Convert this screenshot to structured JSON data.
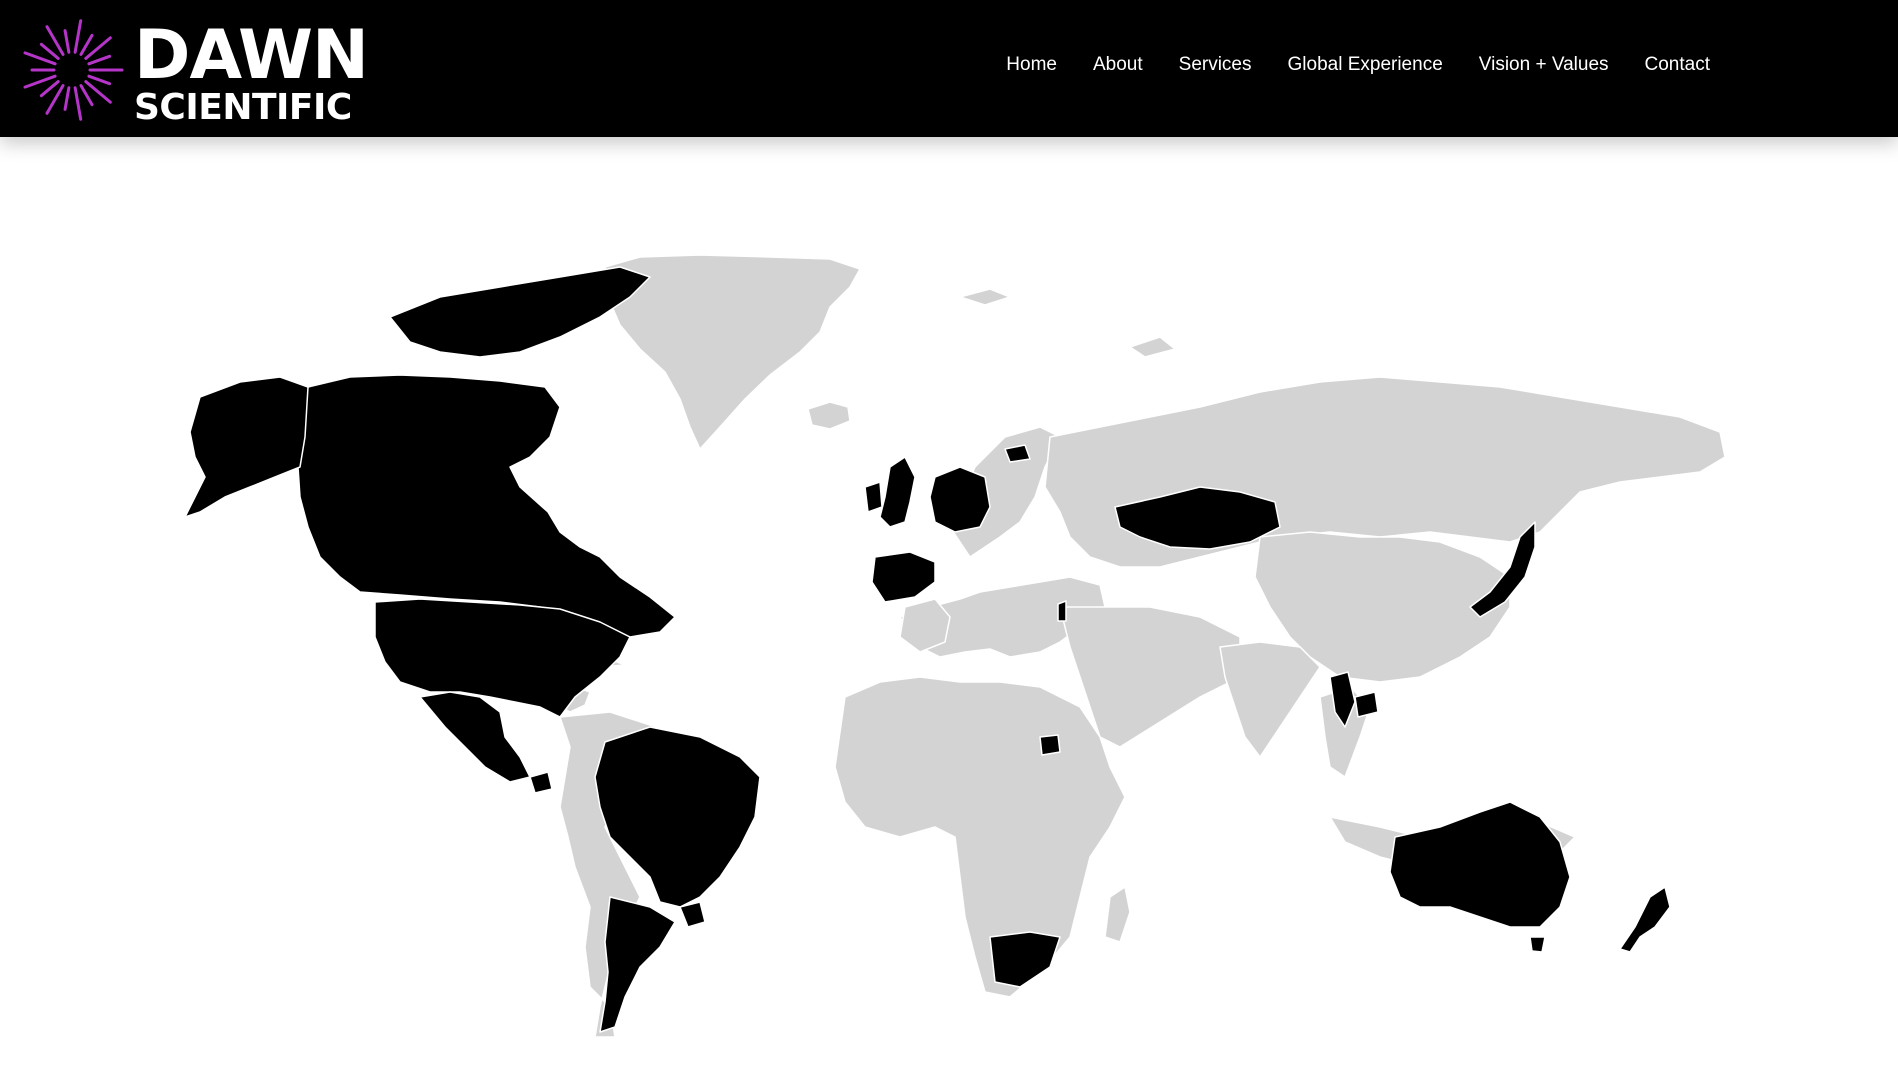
{
  "brand": {
    "line1": "DAWN",
    "line2": "SCIENTIFIC",
    "icon": "sunburst-logo-icon",
    "accent_color": "#b535c8"
  },
  "nav": {
    "items": [
      {
        "label": "Home"
      },
      {
        "label": "About"
      },
      {
        "label": "Services"
      },
      {
        "label": "Global Experience"
      },
      {
        "label": "Vision + Values"
      },
      {
        "label": "Contact"
      }
    ]
  },
  "map": {
    "highlight_color": "#000000",
    "base_color": "#d3d3d3",
    "border_color": "#ffffff",
    "highlighted_regions": [
      "Canada",
      "Alaska (United States)",
      "United States",
      "Mexico",
      "Guatemala",
      "Brazil",
      "Argentina",
      "Uruguay",
      "United Kingdom",
      "Ireland",
      "Spain",
      "Germany",
      "Netherlands",
      "Belgium",
      "Lithuania",
      "Kazakhstan",
      "Israel",
      "Uganda",
      "South Africa",
      "Thailand",
      "Cambodia",
      "Japan",
      "Australia",
      "New Zealand"
    ]
  }
}
